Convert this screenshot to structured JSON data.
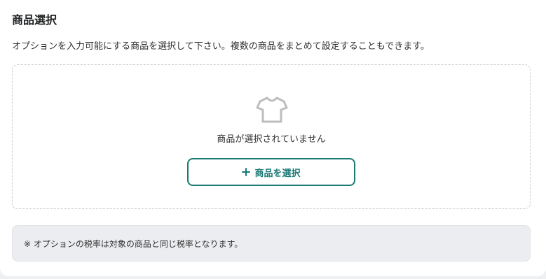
{
  "section": {
    "title": "商品選択",
    "description": "オプションを入力可能にする商品を選択して下さい。複数の商品をまとめて設定することもできます。"
  },
  "empty_state": {
    "icon": "tshirt-icon",
    "message": "商品が選択されていません",
    "button_icon": "plus-icon",
    "button_label": "商品を選択"
  },
  "note": {
    "text": "※ オプションの税率は対象の商品と同じ税率となります。"
  },
  "colors": {
    "accent": "#1a7a74",
    "icon_gray": "#bdbdbd",
    "note_background": "#ebedf0"
  }
}
